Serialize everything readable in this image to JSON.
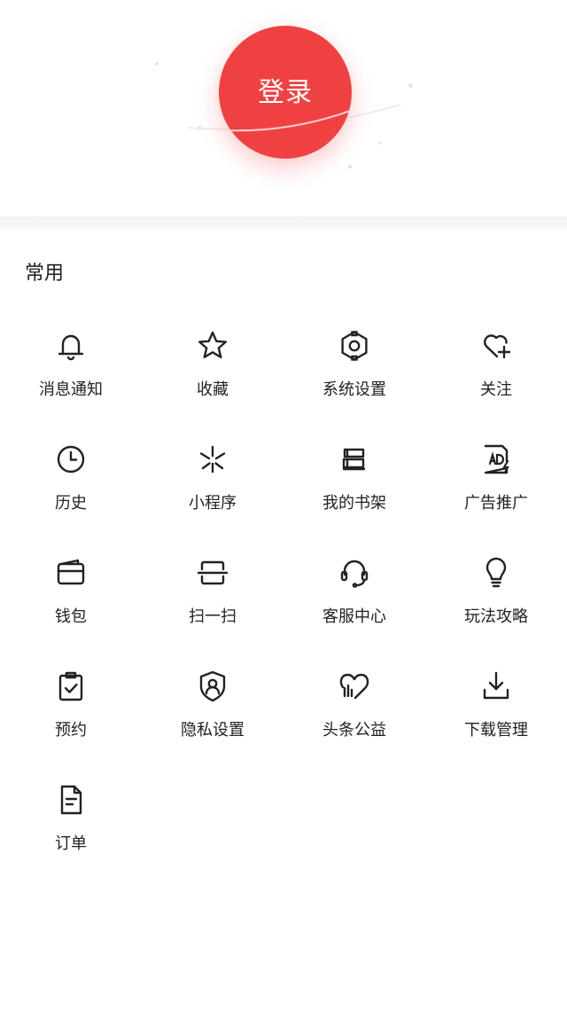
{
  "header": {
    "login_label": "登录",
    "accent_color": "#f04142"
  },
  "common_section": {
    "title": "常用",
    "items": [
      {
        "label": "消息通知",
        "icon": "bell-icon"
      },
      {
        "label": "收藏",
        "icon": "star-icon"
      },
      {
        "label": "系统设置",
        "icon": "gear-icon"
      },
      {
        "label": "关注",
        "icon": "heart-plus-icon"
      },
      {
        "label": "历史",
        "icon": "clock-icon"
      },
      {
        "label": "小程序",
        "icon": "mini-program-icon"
      },
      {
        "label": "我的书架",
        "icon": "bookshelf-icon"
      },
      {
        "label": "广告推广",
        "icon": "ad-icon"
      },
      {
        "label": "钱包",
        "icon": "wallet-icon"
      },
      {
        "label": "扫一扫",
        "icon": "scan-icon"
      },
      {
        "label": "客服中心",
        "icon": "headset-icon"
      },
      {
        "label": "玩法攻略",
        "icon": "lightbulb-icon"
      },
      {
        "label": "预约",
        "icon": "clipboard-check-icon"
      },
      {
        "label": "隐私设置",
        "icon": "shield-user-icon"
      },
      {
        "label": "头条公益",
        "icon": "charity-heart-icon"
      },
      {
        "label": "下载管理",
        "icon": "download-icon"
      },
      {
        "label": "订单",
        "icon": "document-icon"
      }
    ]
  }
}
